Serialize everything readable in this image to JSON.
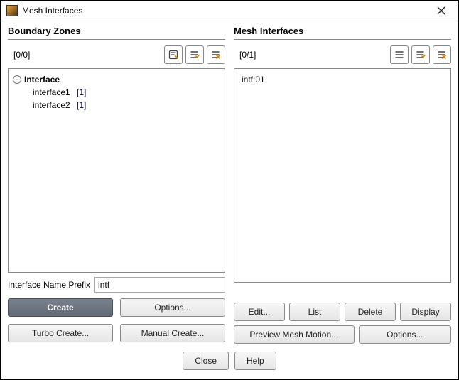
{
  "window": {
    "title": "Mesh Interfaces"
  },
  "left": {
    "title": "Boundary Zones",
    "count": "[0/0]",
    "tree": {
      "root_label": "Interface",
      "items": [
        {
          "name": "interface1",
          "count": "[1]"
        },
        {
          "name": "interface2",
          "count": "[1]"
        }
      ]
    },
    "prefix_label": "Interface Name Prefix",
    "prefix_value": "intf",
    "buttons": {
      "create": "Create",
      "options": "Options...",
      "turbo_create": "Turbo Create...",
      "manual_create": "Manual Create..."
    }
  },
  "right": {
    "title": "Mesh Interfaces",
    "count": "[0/1]",
    "items": [
      "intf:01"
    ],
    "buttons": {
      "edit": "Edit...",
      "list": "List",
      "delete": "Delete",
      "display": "Display",
      "preview": "Preview Mesh Motion...",
      "options": "Options..."
    }
  },
  "footer": {
    "close": "Close",
    "help": "Help"
  },
  "icons": {
    "filter": "filter-icon",
    "select_all": "select-all-icon",
    "deselect_all": "deselect-all-icon",
    "list_lines": "list-lines-icon"
  }
}
